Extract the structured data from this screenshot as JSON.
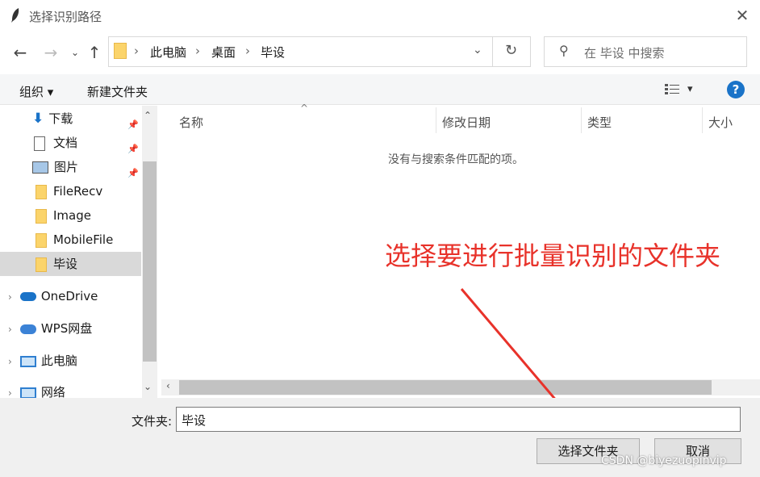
{
  "window": {
    "title": "选择识别路径",
    "close_icon": "close-icon"
  },
  "nav": {
    "back_icon": "arrow-left-icon",
    "forward_icon": "arrow-right-icon",
    "recent_icon": "chevron-down-icon",
    "up_icon": "arrow-up-icon"
  },
  "address": {
    "crumbs": [
      "此电脑",
      "桌面",
      "毕设"
    ],
    "sep": "›",
    "refresh_icon": "refresh-icon"
  },
  "search": {
    "placeholder": "在 毕设 中搜索"
  },
  "toolbar": {
    "organize": "组织 ▾",
    "new_folder": "新建文件夹",
    "view_icon": "view-options-icon",
    "view_arrow": "▾",
    "help": "?"
  },
  "sidebar": {
    "items": [
      {
        "label": "下载",
        "icon": "download-icon",
        "pinned": true
      },
      {
        "label": "文档",
        "icon": "document-icon",
        "pinned": true
      },
      {
        "label": "图片",
        "icon": "picture-icon",
        "pinned": true
      },
      {
        "label": "FileRecv",
        "icon": "folder-icon"
      },
      {
        "label": "Image",
        "icon": "folder-icon"
      },
      {
        "label": "MobileFile",
        "icon": "folder-icon"
      },
      {
        "label": "毕设",
        "icon": "folder-icon",
        "selected": true
      },
      {
        "label": "OneDrive",
        "icon": "cloud-icon"
      },
      {
        "label": "WPS网盘",
        "icon": "cloud-icon"
      },
      {
        "label": "此电脑",
        "icon": "computer-icon"
      },
      {
        "label": "网络",
        "icon": "network-icon"
      }
    ]
  },
  "columns": [
    "名称",
    "修改日期",
    "类型",
    "大小"
  ],
  "empty_message": "没有与搜索条件匹配的项。",
  "bottom": {
    "folder_label": "文件夹:",
    "folder_value": "毕设",
    "select_button": "选择文件夹",
    "cancel_button": "取消"
  },
  "annotation": {
    "text": "选择要进行批量识别的文件夹",
    "color": "#e8322a"
  },
  "watermark": "CSDN @biyezuopinvip"
}
